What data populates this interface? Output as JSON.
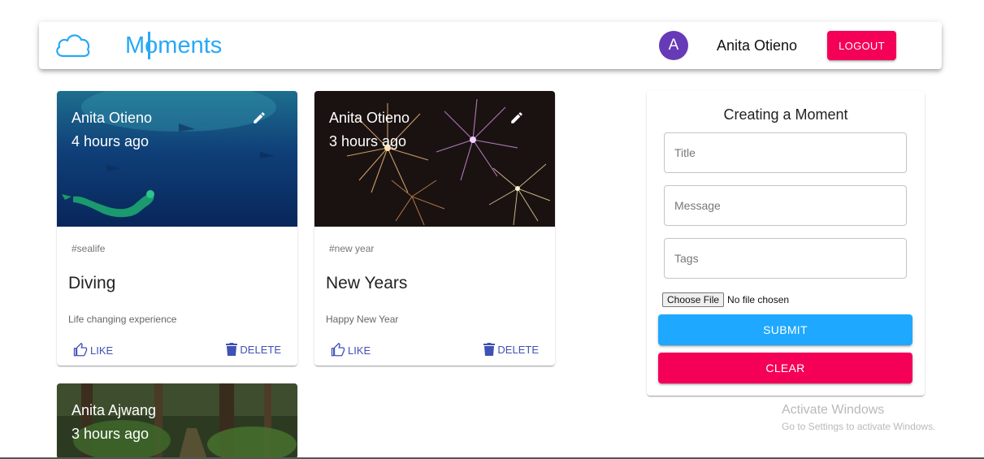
{
  "header": {
    "brand_title": "Moments",
    "avatar_letter": "A",
    "user_name": "Anita Otieno",
    "logout_label": "LOGOUT"
  },
  "posts": [
    {
      "author": "Anita Otieno",
      "time": "4 hours ago",
      "tags": "#sealife",
      "title": "Diving",
      "message": "Life changing experience",
      "like_label": "LIKE",
      "delete_label": "DELETE"
    },
    {
      "author": "Anita Otieno",
      "time": "3 hours ago",
      "tags": "#new year",
      "title": "New Years",
      "message": "Happy New Year",
      "like_label": "LIKE",
      "delete_label": "DELETE"
    },
    {
      "author": "Anita Ajwang",
      "time": "3 hours ago"
    }
  ],
  "form": {
    "heading": "Creating a Moment",
    "title_placeholder": "Title",
    "message_placeholder": "Message",
    "tags_placeholder": "Tags",
    "file_button_label": "Choose File",
    "file_status": "No file chosen",
    "submit_label": "SUBMIT",
    "clear_label": "CLEAR"
  },
  "watermark": {
    "title": "Activate Windows",
    "subtitle": "Go to Settings to activate Windows."
  },
  "colors": {
    "brand": "#29a8f5",
    "secondary": "#f50057",
    "submit": "#1ea8ff",
    "avatar": "#673ab7",
    "action": "#3f51b5"
  },
  "icons": [
    "cloud-icon",
    "edit-icon",
    "thumb-up-icon",
    "delete-icon"
  ]
}
